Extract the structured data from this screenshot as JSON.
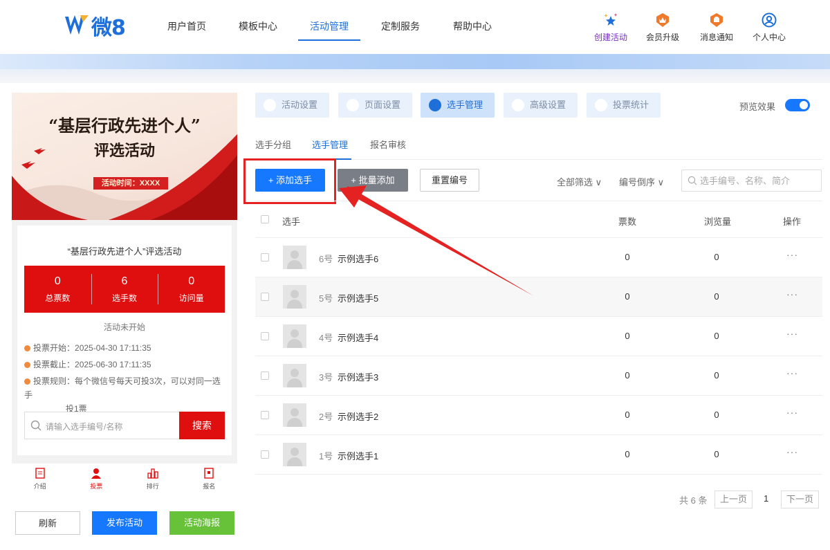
{
  "header": {
    "logo_text": "微8",
    "nav": [
      {
        "label": "用户首页"
      },
      {
        "label": "模板中心"
      },
      {
        "label": "活动管理",
        "active": true
      },
      {
        "label": "定制服务"
      },
      {
        "label": "帮助中心"
      }
    ],
    "actions": [
      {
        "label": "创建活动",
        "icon": "sparkle-star-icon"
      },
      {
        "label": "会员升级",
        "icon": "crown-badge-icon"
      },
      {
        "label": "消息通知",
        "icon": "bell-badge-icon"
      },
      {
        "label": "个人中心",
        "icon": "user-circle-icon"
      }
    ]
  },
  "preview": {
    "poster_title_line1": "“基层行政先进个人”",
    "poster_title_line2": "评选活动",
    "poster_date": "活动时间：XXXX",
    "card_title": "“基层行政先进个人”评选活动",
    "stats": [
      {
        "value": "0",
        "label": "总票数"
      },
      {
        "value": "6",
        "label": "选手数"
      },
      {
        "value": "0",
        "label": "访问量"
      }
    ],
    "status": "活动未开始",
    "rules": [
      {
        "label": "投票开始：",
        "value": "2025-04-30 17:11:35"
      },
      {
        "label": "投票截止：",
        "value": "2025-06-30 17:11:35"
      },
      {
        "label": "投票规则：",
        "value": "每个微信号每天可投3次，可以对同一选手",
        "value2": "投1票"
      }
    ],
    "search_placeholder": "请输入选手编号/名称",
    "search_button": "搜索",
    "tabbar": [
      {
        "label": "介绍",
        "icon": "document-icon"
      },
      {
        "label": "投票",
        "icon": "person-icon",
        "active": true
      },
      {
        "label": "排行",
        "icon": "bar-chart-icon"
      },
      {
        "label": "报名",
        "icon": "register-icon"
      }
    ]
  },
  "bottom_buttons": {
    "refresh": "刷新",
    "publish": "发布活动",
    "poster": "活动海报"
  },
  "steps": [
    {
      "label": "活动设置",
      "icon": "heart-icon"
    },
    {
      "label": "页面设置",
      "icon": "page-icon"
    },
    {
      "label": "选手管理",
      "icon": "contestant-icon",
      "active": true
    },
    {
      "label": "高级设置",
      "icon": "percent-icon"
    },
    {
      "label": "投票统计",
      "icon": "stats-icon"
    }
  ],
  "preview_toggle": {
    "label": "预览效果",
    "on": true
  },
  "sub_tabs": [
    {
      "label": "选手分组"
    },
    {
      "label": "选手管理",
      "active": true
    },
    {
      "label": "报名审核"
    }
  ],
  "toolbar": {
    "add": "+ 添加选手",
    "batch": "+ 批量添加",
    "reset": "重置编号",
    "filter_all": "全部筛选 ∨",
    "filter_sort": "编号倒序 ∨",
    "search_placeholder": "选手编号、名称、简介"
  },
  "table": {
    "headers": {
      "select": "选手",
      "votes": "票数",
      "views": "浏览量",
      "ops": "操作"
    },
    "rows": [
      {
        "no": "6号",
        "name": "示例选手6",
        "votes": "0",
        "views": "0",
        "ops": "···"
      },
      {
        "no": "5号",
        "name": "示例选手5",
        "votes": "0",
        "views": "0",
        "ops": "···"
      },
      {
        "no": "4号",
        "name": "示例选手4",
        "votes": "0",
        "views": "0",
        "ops": "···"
      },
      {
        "no": "3号",
        "name": "示例选手3",
        "votes": "0",
        "views": "0",
        "ops": "···"
      },
      {
        "no": "2号",
        "name": "示例选手2",
        "votes": "0",
        "views": "0",
        "ops": "···"
      },
      {
        "no": "1号",
        "name": "示例选手1",
        "votes": "0",
        "views": "0",
        "ops": "···"
      }
    ]
  },
  "pagination": {
    "total": "共 6 条",
    "prev": "上一页",
    "current": "1",
    "next": "下一页"
  },
  "colors": {
    "primary": "#1677ff",
    "brand_red": "#e00f0f",
    "annotation_red": "#e52222",
    "green": "#67c23a"
  }
}
